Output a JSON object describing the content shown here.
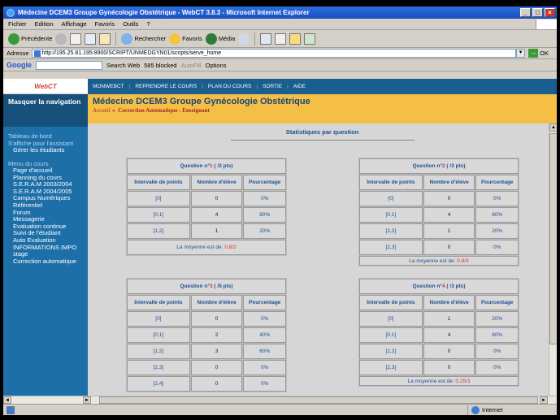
{
  "window": {
    "title": "Médecine DCEM3 Groupe Gynécologie Obstétrique - WebCT 3.8.3 - Microsoft Internet Explorer",
    "min": "_",
    "max": "□",
    "close": "×"
  },
  "menu": [
    "Fichier",
    "Edition",
    "Affichage",
    "Favoris",
    "Outils",
    "?"
  ],
  "toolbar": {
    "back": "Précédente",
    "search": "Rechercher",
    "favorites": "Favoris",
    "media": "Média"
  },
  "address": {
    "label": "Adresse",
    "url": "http://195.25.81.195:8900/SCRIPT/UNMEDGYN01/scripts/serve_home",
    "go": "OK"
  },
  "googlebar": {
    "logo": "Google",
    "search_web": "Search Web",
    "blocked": "585 blocked",
    "autofill": "AutoFill",
    "options": "Options"
  },
  "webct": {
    "logo": "WebCT",
    "nav": [
      "MONWEBCT",
      "REPRENDRE LE COURS",
      "PLAN DU COURS",
      "SORTIE",
      "AIDE"
    ],
    "hide_nav": "Masquer la navigation",
    "sidebar_groups": [
      {
        "title": "Tableau de bord",
        "subtitle": "S'affiche pour l'assistant",
        "items": [
          "Gérer les étudiants"
        ]
      },
      {
        "title": "Menu du cours",
        "items": [
          "Page d'accueil",
          "Planning du cours",
          "S.E.R.A.M 2003/2004",
          "S.E.R.A.M 2004/2005",
          "Campus Numériques",
          "Référentiel",
          "Forum",
          "Messagerie",
          "Evaluation continue",
          "Suivi de l'étudiant",
          "Auto Evaluation",
          "INFORMATIONS IMPO",
          "stage",
          "Correction automatique"
        ]
      }
    ],
    "course_title": "Médecine DCEM3 Groupe Gynécologie Obstétrique",
    "breadcrumb": {
      "home": "Accueil",
      "separator": "▸",
      "current": "Correction Automatique - Enseignant"
    },
    "page_heading": "Statistiques par question",
    "columns": [
      "Intervalle de points",
      "Nombre d'élève",
      "Pourcentage"
    ],
    "mean_label": "La moyenne est de:",
    "questions": [
      {
        "prefix": "Question n°",
        "num": "1",
        "pts": " ( /2 pts)",
        "rows": [
          [
            "[0]",
            "0",
            "0%"
          ],
          [
            "[0,1]",
            "4",
            "80%"
          ],
          [
            "[1,2]",
            "1",
            "20%"
          ]
        ],
        "mean": "0.8/2"
      },
      {
        "prefix": "Question n°",
        "num": "2",
        "pts": " ( /3 pts)",
        "rows": [
          [
            "[0]",
            "0",
            "0%"
          ],
          [
            "[0,1]",
            "4",
            "80%"
          ],
          [
            "[1,2]",
            "1",
            "20%"
          ],
          [
            "[2,3]",
            "0",
            "0%"
          ]
        ],
        "mean": "0.9/3"
      },
      {
        "prefix": "Question n°",
        "num": "3",
        "pts": " ( /5 pts)",
        "rows": [
          [
            "[0]",
            "0",
            "0%"
          ],
          [
            "[0,1]",
            "2",
            "40%"
          ],
          [
            "[1,2]",
            "3",
            "60%"
          ],
          [
            "[2,3]",
            "0",
            "0%"
          ],
          [
            "[2,4]",
            "0",
            "0%"
          ]
        ],
        "mean": ""
      },
      {
        "prefix": "Question n°",
        "num": "4",
        "pts": " ( /3 pts)",
        "rows": [
          [
            "[0]",
            "1",
            "20%"
          ],
          [
            "[0,1]",
            "4",
            "80%"
          ],
          [
            "[1,2]",
            "0",
            "0%"
          ],
          [
            "[2,3]",
            "0",
            "0%"
          ]
        ],
        "mean": "0.25/3"
      }
    ]
  },
  "status": {
    "zone": "Internet"
  }
}
